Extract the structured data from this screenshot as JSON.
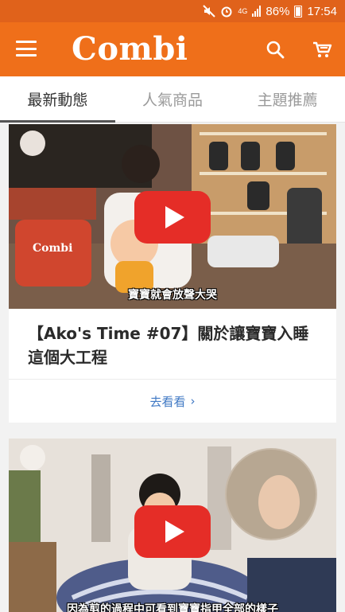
{
  "status_bar": {
    "battery": "86%",
    "time": "17:54",
    "network": "4G"
  },
  "app_bar": {
    "logo": "Combi",
    "accent_color": "#ef6f1a"
  },
  "tabs": [
    {
      "label": "最新動態",
      "active": true
    },
    {
      "label": "人氣商品",
      "active": false
    },
    {
      "label": "主題推薦",
      "active": false
    }
  ],
  "feed": [
    {
      "caption": "寶寶就會放聲大哭",
      "title": "【Ako's Time #07】關於讓寶寶入睡這個大工程",
      "more_label": "去看看",
      "more_icon": "chevron-right-icon"
    },
    {
      "caption": "因為剪的過程中可看到寶寶指甲全部的樣子"
    }
  ]
}
